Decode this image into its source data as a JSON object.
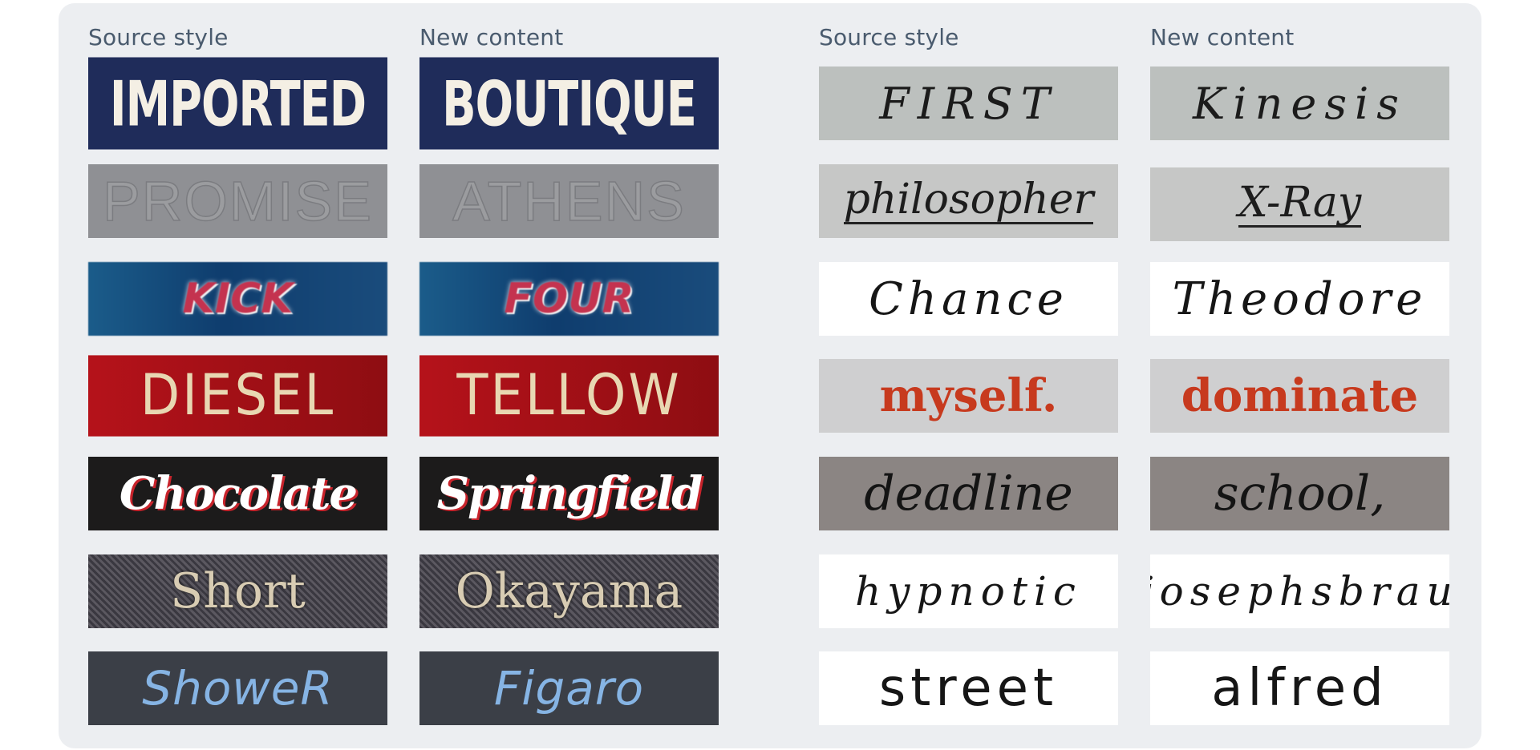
{
  "headers": {
    "left_source": "Source style",
    "left_new": "New content",
    "right_source": "Source style",
    "right_new": "New content"
  },
  "scene_text": [
    {
      "source": "IMPORTED",
      "new": "BOUTIQUE"
    },
    {
      "source": "PROMISE",
      "new": "ATHENS"
    },
    {
      "source": "KICK",
      "new": "FOUR"
    },
    {
      "source": "DIESEL",
      "new": "TELLOW"
    },
    {
      "source": "Chocolate",
      "new": "Springfield"
    },
    {
      "source": "Short",
      "new": "Okayama"
    },
    {
      "source": "ShoweR",
      "new": "Figaro"
    }
  ],
  "handwriting": [
    {
      "source": "FIRST",
      "new": "Kinesis"
    },
    {
      "source": "philosopher",
      "new": "X-Ray"
    },
    {
      "source": "Chance",
      "new": "Theodore"
    },
    {
      "source": "myself.",
      "new": "dominate"
    },
    {
      "source": "deadline",
      "new": "school,"
    },
    {
      "source": "hypnotic",
      "new": "josephsbrau"
    },
    {
      "source": "street",
      "new": "alfred"
    }
  ]
}
